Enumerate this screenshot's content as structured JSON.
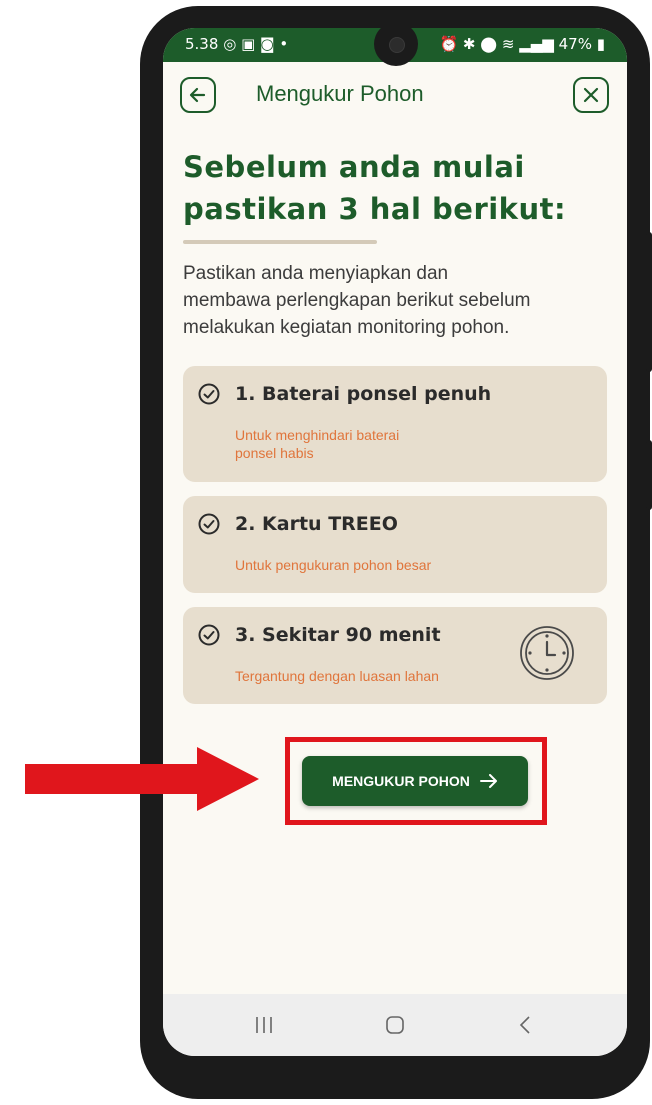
{
  "status_bar": {
    "time": "5.38",
    "left_icons": [
      "whatsapp-icon",
      "calendar-icon",
      "instagram-icon",
      "dot-icon"
    ],
    "right_icons": [
      "alarm-icon",
      "bluetooth-icon",
      "location-icon",
      "wifi-icon",
      "signal-icon"
    ],
    "battery": "47%"
  },
  "header": {
    "back_icon": "back-arrow-icon",
    "title": "Mengukur Pohon",
    "close_icon": "close-icon"
  },
  "main": {
    "heading_line1": "Sebelum anda mulai",
    "heading_line2": "pastikan 3 hal berikut:",
    "intro_line1": "Pastikan anda menyiapkan dan",
    "intro_line2": "membawa perlengkapan berikut sebelum",
    "intro_line3": "melakukan kegiatan monitoring pohon.",
    "items": [
      {
        "title": "1. Baterai ponsel penuh",
        "sub1": "Untuk menghindari baterai",
        "sub2": "ponsel habis"
      },
      {
        "title": "2. Kartu TREEO",
        "sub1": "Untuk pengukuran pohon besar"
      },
      {
        "title": "3. Sekitar 90 menit",
        "sub1": "Tergantung dengan luasan lahan",
        "icon": "clock-icon"
      }
    ],
    "cta_label": "MENGUKUR POHON",
    "cta_icon": "arrow-right-icon"
  },
  "colors": {
    "primary_green": "#1d5c2a",
    "card_bg": "#e7dece",
    "subtext_orange": "#e0753c",
    "annotation_red": "#e0161c"
  }
}
